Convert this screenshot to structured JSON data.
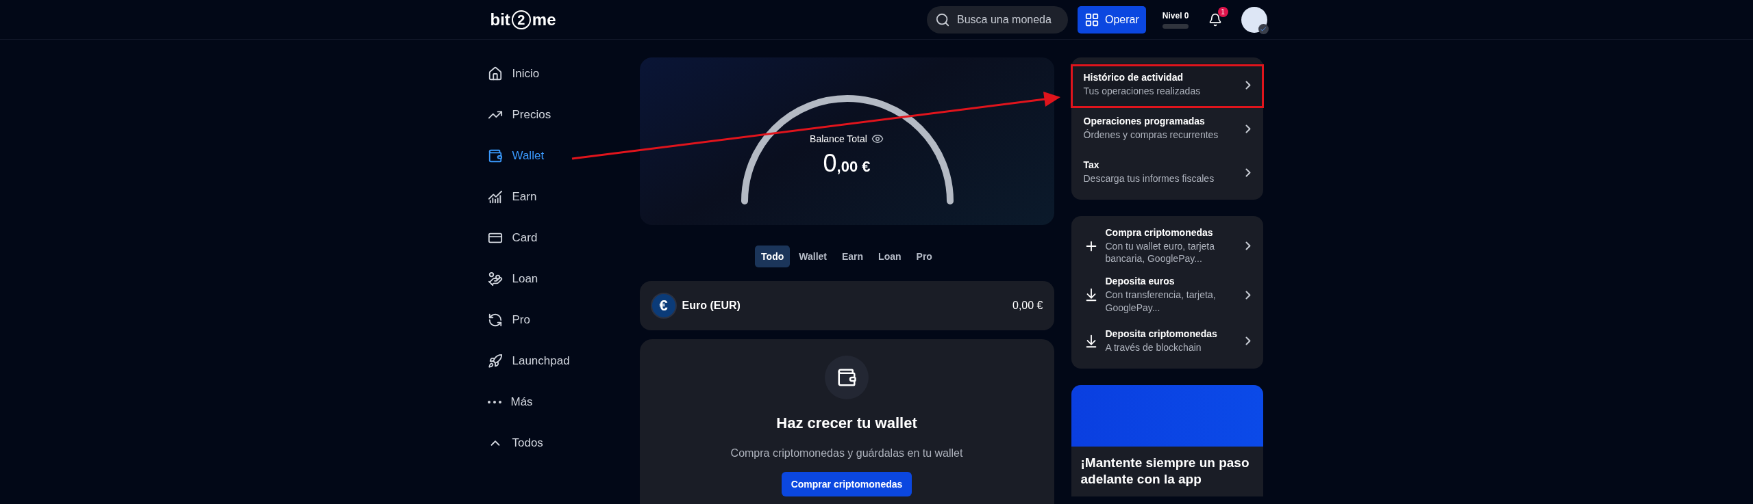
{
  "header": {
    "logo": {
      "left": "bit",
      "mid": "2",
      "right": "me"
    },
    "search": {
      "placeholder": "Busca una moneda"
    },
    "operate_button": "Operar",
    "level": {
      "label": "Nivel 0"
    },
    "notifications": {
      "count": "1"
    }
  },
  "sidebar": {
    "items": [
      {
        "label": "Inicio",
        "selected": false
      },
      {
        "label": "Precios",
        "selected": false
      },
      {
        "label": "Wallet",
        "selected": true
      },
      {
        "label": "Earn",
        "selected": false
      },
      {
        "label": "Card",
        "selected": false
      },
      {
        "label": "Loan",
        "selected": false
      },
      {
        "label": "Pro",
        "selected": false
      },
      {
        "label": "Launchpad",
        "selected": false
      },
      {
        "label": "Más",
        "selected": false
      },
      {
        "label": "Todos",
        "selected": false
      }
    ]
  },
  "balance": {
    "label": "Balance Total",
    "integer": "0",
    "decimals": ",00",
    "currency": "€"
  },
  "tabs": [
    {
      "label": "Todo",
      "selected": true
    },
    {
      "label": "Wallet",
      "selected": false
    },
    {
      "label": "Earn",
      "selected": false
    },
    {
      "label": "Loan",
      "selected": false
    },
    {
      "label": "Pro",
      "selected": false
    }
  ],
  "assets": [
    {
      "symbol": "€",
      "name": "Euro (EUR)",
      "amount": "0,00 €"
    }
  ],
  "empty_state": {
    "title": "Haz crecer tu wallet",
    "text": "Compra criptomonedas y guárdalas en tu wallet",
    "button": "Comprar criptomonedas"
  },
  "links": [
    {
      "title": "Histórico de actividad",
      "subtitle": "Tus operaciones realizadas",
      "highlighted": true
    },
    {
      "title": "Operaciones programadas",
      "subtitle": "Órdenes y compras recurrentes",
      "highlighted": false
    },
    {
      "title": "Tax",
      "subtitle": "Descarga tus informes fiscales",
      "highlighted": false
    }
  ],
  "actions": [
    {
      "kind": "buy",
      "title": "Compra criptomonedas",
      "subtitle": "Con tu wallet euro, tarjeta bancaria, GooglePay..."
    },
    {
      "kind": "deposit",
      "title": "Deposita euros",
      "subtitle": "Con transferencia, tarjeta, GooglePay..."
    },
    {
      "kind": "deposit",
      "title": "Deposita criptomonedas",
      "subtitle": "A través de blockchain"
    }
  ],
  "promo": {
    "title": "¡Mantente siempre un paso adelante con la app"
  },
  "annotation": {
    "arrow": true
  }
}
